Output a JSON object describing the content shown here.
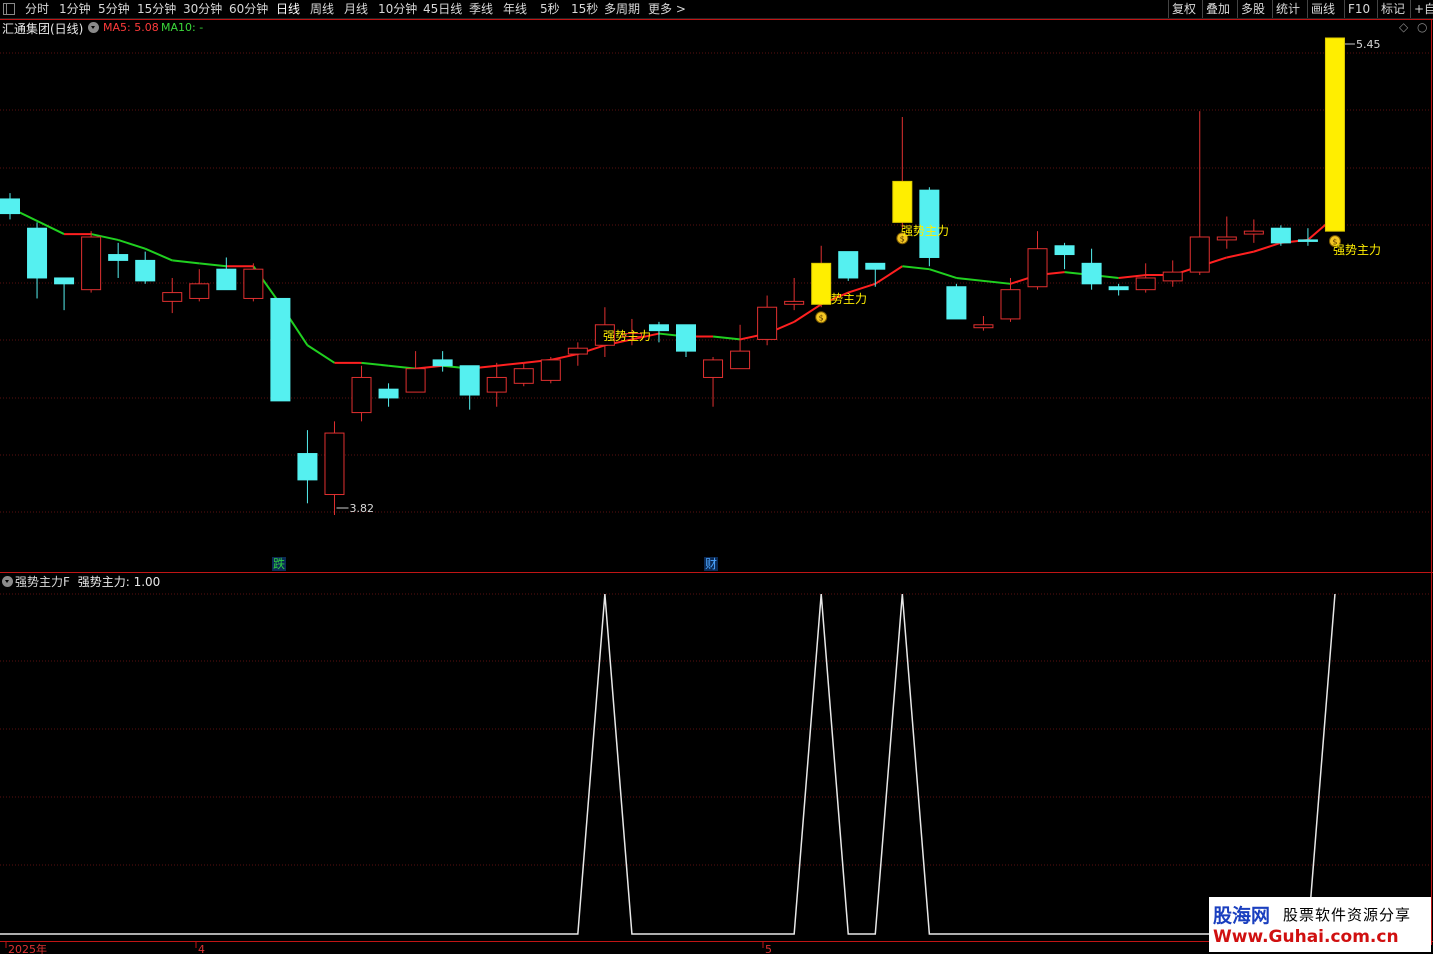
{
  "toolbar": {
    "left_items": [
      "分时",
      "1分钟",
      "5分钟",
      "15分钟",
      "30分钟",
      "60分钟",
      "日线",
      "周线",
      "月线",
      "10分钟",
      "45日线",
      "季线",
      "年线",
      "5秒",
      "15秒",
      "多周期",
      "更多 >"
    ],
    "active_item": "日线",
    "right_items": [
      "复权",
      "叠加",
      "多股",
      "统计",
      "画线",
      "F10",
      "标记",
      "+自"
    ]
  },
  "main_panel": {
    "title": "汇通集团(日线)",
    "ma5_label": "MA5: 5.08",
    "ma10_label": "MA10: -",
    "high_label": "5.45",
    "low_label": "3.82",
    "event_markers": [
      {
        "text": "跌",
        "color": "#2ecc40",
        "x": 279
      },
      {
        "text": "财",
        "color": "#4da6ff",
        "x": 711
      }
    ],
    "signal_labels": [
      {
        "text": "强势主力",
        "x": 603,
        "y": 340
      },
      {
        "text": "强势主力",
        "x": 819,
        "y": 303
      },
      {
        "text": "强势主力",
        "x": 901,
        "y": 235
      },
      {
        "text": "强势主力",
        "x": 1333,
        "y": 254
      }
    ]
  },
  "indicator_panel": {
    "title": "强势主力F",
    "value_label": "强势主力: 1.00"
  },
  "x_axis": {
    "labels": [
      "2025年",
      "4",
      "5"
    ]
  },
  "colors": {
    "up": "#e03030",
    "down": "#55f0f0",
    "signal": "#ffee00",
    "ma_up": "#ff2020",
    "ma_down": "#20d020",
    "grid": "#5a1010",
    "border": "#c01515"
  },
  "chart_data": {
    "type": "candlestick",
    "price_range": [
      3.82,
      5.45
    ],
    "candles": [
      {
        "o": 4.9,
        "c": 4.85,
        "h": 4.92,
        "l": 4.83,
        "dir": "down"
      },
      {
        "o": 4.8,
        "c": 4.63,
        "h": 4.82,
        "l": 4.56,
        "dir": "down"
      },
      {
        "o": 4.63,
        "c": 4.61,
        "h": 4.63,
        "l": 4.52,
        "dir": "down"
      },
      {
        "o": 4.59,
        "c": 4.77,
        "h": 4.79,
        "l": 4.58,
        "dir": "up"
      },
      {
        "o": 4.71,
        "c": 4.69,
        "h": 4.75,
        "l": 4.63,
        "dir": "down"
      },
      {
        "o": 4.69,
        "c": 4.62,
        "h": 4.72,
        "l": 4.61,
        "dir": "down"
      },
      {
        "o": 4.55,
        "c": 4.58,
        "h": 4.63,
        "l": 4.51,
        "dir": "up"
      },
      {
        "o": 4.56,
        "c": 4.61,
        "h": 4.66,
        "l": 4.55,
        "dir": "up"
      },
      {
        "o": 4.66,
        "c": 4.59,
        "h": 4.7,
        "l": 4.59,
        "dir": "down"
      },
      {
        "o": 4.56,
        "c": 4.66,
        "h": 4.68,
        "l": 4.55,
        "dir": "up"
      },
      {
        "o": 4.56,
        "c": 4.21,
        "h": 4.56,
        "l": 4.21,
        "dir": "down"
      },
      {
        "o": 4.03,
        "c": 3.94,
        "h": 4.11,
        "l": 3.86,
        "dir": "down"
      },
      {
        "o": 3.89,
        "c": 4.1,
        "h": 4.14,
        "l": 3.82,
        "dir": "up"
      },
      {
        "o": 4.17,
        "c": 4.29,
        "h": 4.33,
        "l": 4.14,
        "dir": "up"
      },
      {
        "o": 4.25,
        "c": 4.22,
        "h": 4.27,
        "l": 4.19,
        "dir": "down"
      },
      {
        "o": 4.24,
        "c": 4.32,
        "h": 4.38,
        "l": 4.24,
        "dir": "up"
      },
      {
        "o": 4.35,
        "c": 4.33,
        "h": 4.38,
        "l": 4.31,
        "dir": "down"
      },
      {
        "o": 4.33,
        "c": 4.23,
        "h": 4.33,
        "l": 4.18,
        "dir": "down"
      },
      {
        "o": 4.24,
        "c": 4.29,
        "h": 4.34,
        "l": 4.19,
        "dir": "up"
      },
      {
        "o": 4.27,
        "c": 4.32,
        "h": 4.34,
        "l": 4.26,
        "dir": "up"
      },
      {
        "o": 4.28,
        "c": 4.35,
        "h": 4.36,
        "l": 4.27,
        "dir": "up"
      },
      {
        "o": 4.37,
        "c": 4.39,
        "h": 4.41,
        "l": 4.33,
        "dir": "up"
      },
      {
        "o": 4.4,
        "c": 4.47,
        "h": 4.53,
        "l": 4.36,
        "dir": "up"
      },
      {
        "o": 4.43,
        "c": 4.44,
        "h": 4.49,
        "l": 4.4,
        "dir": "up"
      },
      {
        "o": 4.47,
        "c": 4.45,
        "h": 4.48,
        "l": 4.41,
        "dir": "down"
      },
      {
        "o": 4.47,
        "c": 4.38,
        "h": 4.47,
        "l": 4.36,
        "dir": "down"
      },
      {
        "o": 4.35,
        "c": 4.29,
        "h": 4.36,
        "l": 4.19,
        "dir": "up"
      },
      {
        "o": 4.32,
        "c": 4.38,
        "h": 4.47,
        "l": 4.32,
        "dir": "up"
      },
      {
        "o": 4.42,
        "c": 4.53,
        "h": 4.57,
        "l": 4.4,
        "dir": "up"
      },
      {
        "o": 4.54,
        "c": 4.55,
        "h": 4.63,
        "l": 4.52,
        "dir": "up"
      },
      {
        "o": 4.54,
        "c": 4.68,
        "h": 4.74,
        "l": 4.53,
        "dir": "up",
        "signal": true
      },
      {
        "o": 4.72,
        "c": 4.63,
        "h": 4.72,
        "l": 4.62,
        "dir": "down"
      },
      {
        "o": 4.68,
        "c": 4.66,
        "h": 4.68,
        "l": 4.6,
        "dir": "down"
      },
      {
        "o": 4.82,
        "c": 4.96,
        "h": 5.18,
        "l": 4.8,
        "dir": "up",
        "signal": true
      },
      {
        "o": 4.93,
        "c": 4.7,
        "h": 4.94,
        "l": 4.67,
        "dir": "down"
      },
      {
        "o": 4.6,
        "c": 4.49,
        "h": 4.61,
        "l": 4.49,
        "dir": "down"
      },
      {
        "o": 4.47,
        "c": 4.46,
        "h": 4.5,
        "l": 4.45,
        "dir": "up"
      },
      {
        "o": 4.49,
        "c": 4.59,
        "h": 4.63,
        "l": 4.48,
        "dir": "up"
      },
      {
        "o": 4.6,
        "c": 4.73,
        "h": 4.79,
        "l": 4.59,
        "dir": "up"
      },
      {
        "o": 4.74,
        "c": 4.71,
        "h": 4.75,
        "l": 4.66,
        "dir": "down"
      },
      {
        "o": 4.68,
        "c": 4.61,
        "h": 4.73,
        "l": 4.59,
        "dir": "down"
      },
      {
        "o": 4.6,
        "c": 4.59,
        "h": 4.61,
        "l": 4.57,
        "dir": "down"
      },
      {
        "o": 4.59,
        "c": 4.63,
        "h": 4.68,
        "l": 4.58,
        "dir": "up"
      },
      {
        "o": 4.62,
        "c": 4.65,
        "h": 4.69,
        "l": 4.6,
        "dir": "up"
      },
      {
        "o": 4.65,
        "c": 4.77,
        "h": 5.2,
        "l": 4.64,
        "dir": "up"
      },
      {
        "o": 4.76,
        "c": 4.77,
        "h": 4.84,
        "l": 4.73,
        "dir": "up"
      },
      {
        "o": 4.78,
        "c": 4.79,
        "h": 4.83,
        "l": 4.75,
        "dir": "up"
      },
      {
        "o": 4.8,
        "c": 4.75,
        "h": 4.81,
        "l": 4.74,
        "dir": "down"
      },
      {
        "o": 4.76,
        "c": 4.76,
        "h": 4.8,
        "l": 4.74,
        "dir": "down"
      },
      {
        "o": 4.79,
        "c": 5.45,
        "h": 5.45,
        "l": 4.79,
        "dir": "up",
        "signal": true
      }
    ],
    "ma5": [
      {
        "i": 0,
        "v": 4.87
      },
      {
        "i": 2,
        "v": 4.78
      },
      {
        "i": 3,
        "v": 4.78
      },
      {
        "i": 4,
        "v": 4.76
      },
      {
        "i": 5,
        "v": 4.73
      },
      {
        "i": 6,
        "v": 4.69
      },
      {
        "i": 7,
        "v": 4.68
      },
      {
        "i": 8,
        "v": 4.67
      },
      {
        "i": 9,
        "v": 4.67
      },
      {
        "i": 10,
        "v": 4.54
      },
      {
        "i": 11,
        "v": 4.4
      },
      {
        "i": 12,
        "v": 4.34
      },
      {
        "i": 13,
        "v": 4.34
      },
      {
        "i": 14,
        "v": 4.33
      },
      {
        "i": 15,
        "v": 4.32
      },
      {
        "i": 16,
        "v": 4.33
      },
      {
        "i": 17,
        "v": 4.32
      },
      {
        "i": 18,
        "v": 4.33
      },
      {
        "i": 19,
        "v": 4.34
      },
      {
        "i": 20,
        "v": 4.35
      },
      {
        "i": 21,
        "v": 4.37
      },
      {
        "i": 22,
        "v": 4.4
      },
      {
        "i": 23,
        "v": 4.42
      },
      {
        "i": 24,
        "v": 4.44
      },
      {
        "i": 25,
        "v": 4.43
      },
      {
        "i": 26,
        "v": 4.43
      },
      {
        "i": 27,
        "v": 4.42
      },
      {
        "i": 28,
        "v": 4.44
      },
      {
        "i": 29,
        "v": 4.48
      },
      {
        "i": 30,
        "v": 4.54
      },
      {
        "i": 31,
        "v": 4.58
      },
      {
        "i": 32,
        "v": 4.61
      },
      {
        "i": 33,
        "v": 4.67
      },
      {
        "i": 34,
        "v": 4.66
      },
      {
        "i": 35,
        "v": 4.63
      },
      {
        "i": 37,
        "v": 4.61
      },
      {
        "i": 38,
        "v": 4.64
      },
      {
        "i": 39,
        "v": 4.65
      },
      {
        "i": 40,
        "v": 4.64
      },
      {
        "i": 41,
        "v": 4.63
      },
      {
        "i": 42,
        "v": 4.64
      },
      {
        "i": 43,
        "v": 4.64
      },
      {
        "i": 44,
        "v": 4.67
      },
      {
        "i": 45,
        "v": 4.7
      },
      {
        "i": 46,
        "v": 4.72
      },
      {
        "i": 47,
        "v": 4.75
      },
      {
        "i": 48,
        "v": 4.76
      },
      {
        "i": 49,
        "v": 4.84
      }
    ],
    "indicator": {
      "name": "强势主力",
      "ylim": [
        0,
        1
      ],
      "values": [
        0,
        0,
        0,
        0,
        0,
        0,
        0,
        0,
        0,
        0,
        0,
        0,
        0,
        0,
        0,
        0,
        0,
        0,
        0,
        0,
        0,
        0,
        1,
        0,
        0,
        0,
        0,
        0,
        0,
        0,
        1,
        0,
        0,
        1,
        0,
        0,
        0,
        0,
        0,
        0,
        0,
        0,
        0,
        0,
        0,
        0,
        0,
        0,
        0,
        1
      ]
    }
  }
}
